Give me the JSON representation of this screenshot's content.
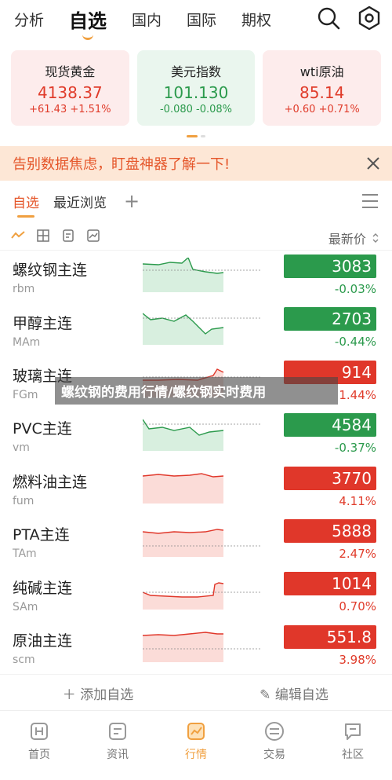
{
  "top_nav": {
    "tabs": [
      "分析",
      "自选",
      "国内",
      "国际",
      "期权"
    ],
    "icons": [
      "search-icon",
      "settings-icon"
    ]
  },
  "indexes": [
    {
      "name": "现货黄金",
      "price": "4138.37",
      "change": "+61.43 +1.51%",
      "trend": "up"
    },
    {
      "name": "美元指数",
      "price": "101.130",
      "change": "-0.080 -0.08%",
      "trend": "down"
    },
    {
      "name": "wti原油",
      "price": "85.14",
      "change": "+0.60 +0.71%",
      "trend": "up"
    }
  ],
  "banner": {
    "text": "告别数据焦虑，盯盘神器了解一下!"
  },
  "watch_tabs": {
    "tabs": [
      "自选",
      "最近浏览"
    ],
    "add": "+"
  },
  "toolbar": {
    "sort_label": "最新价"
  },
  "quotes": [
    {
      "name": "螺纹钢主连",
      "code": "rbm",
      "price": "3083",
      "pct": "-0.03%",
      "trend": "down"
    },
    {
      "name": "甲醇主连",
      "code": "MAm",
      "price": "2703",
      "pct": "-0.44%",
      "trend": "down"
    },
    {
      "name": "玻璃主连",
      "code": "FGm",
      "price": "914",
      "pct": "1.44%",
      "trend": "up"
    },
    {
      "name": "PVC主连",
      "code": "vm",
      "price": "4584",
      "pct": "-0.37%",
      "trend": "down"
    },
    {
      "name": "燃料油主连",
      "code": "fum",
      "price": "3770",
      "pct": "4.11%",
      "trend": "up"
    },
    {
      "name": "PTA主连",
      "code": "TAm",
      "price": "5888",
      "pct": "2.47%",
      "trend": "up"
    },
    {
      "name": "纯碱主连",
      "code": "SAm",
      "price": "1014",
      "pct": "0.70%",
      "trend": "up"
    },
    {
      "name": "原油主连",
      "code": "scm",
      "price": "551.8",
      "pct": "3.98%",
      "trend": "up"
    }
  ],
  "edit_row": {
    "add_label": "添加自选",
    "edit_label": "编辑自选"
  },
  "bottom_nav": {
    "items": [
      "首页",
      "资讯",
      "行情",
      "交易",
      "社区"
    ],
    "active_index": 2
  },
  "overlay": {
    "text": "螺纹钢的费用行情/螺纹钢实时费用"
  },
  "colors": {
    "up": "#e0372a",
    "down": "#2b9a4c",
    "accent": "#f0a040"
  }
}
